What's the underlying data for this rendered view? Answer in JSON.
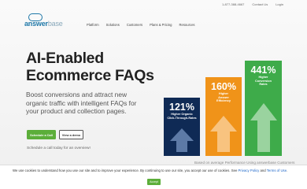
{
  "topbar": {
    "phone": "1-877-388-4667",
    "contact": "Contact Us",
    "login": "Login"
  },
  "logo": {
    "part1": "answer",
    "part2": "base"
  },
  "nav": {
    "items": [
      "Platform",
      "Solutions",
      "Customers",
      "Plans & Pricing",
      "Resources"
    ]
  },
  "hero": {
    "title_line1": "AI-Enabled",
    "title_line2": "Ecommerce FAQs",
    "sub_line1": "Boost conversions and attract new",
    "sub_line2": "organic traffic with intelligent FAQs for",
    "sub_line3": "your product and collection pages.",
    "cta_primary": "Schedule a Call",
    "cta_secondary": "View a demo",
    "schedule_text": "Schedule a call today for an overview!"
  },
  "stats": [
    {
      "value": "121%",
      "label_line1": "Higher Organic",
      "label_line2": "Click-Through-Rates",
      "color": "#0f2a55"
    },
    {
      "value": "160%",
      "label_line1": "Higher",
      "label_line2": "Answer",
      "label_line3": "Efficiency",
      "color": "#f09319"
    },
    {
      "value": "441%",
      "label_line1": "Higher",
      "label_line2": "Conversion",
      "label_line3": "Rates",
      "color": "#3eab4a"
    }
  ],
  "stats_caption": "Based on average Performance Using answerbase Customers",
  "cookie": {
    "text": "We use cookies to understand how you use our site and to improve your experience. By continuing to use our site, you accept our use of cookies. See ",
    "privacy": "Privacy Policy",
    "and": " and ",
    "terms": "Terms of Use",
    "button": "Accept"
  },
  "colors": {
    "brand_blue": "#1f78a8",
    "cta_green": "#5cae3a",
    "link_blue": "#1a64c8"
  }
}
